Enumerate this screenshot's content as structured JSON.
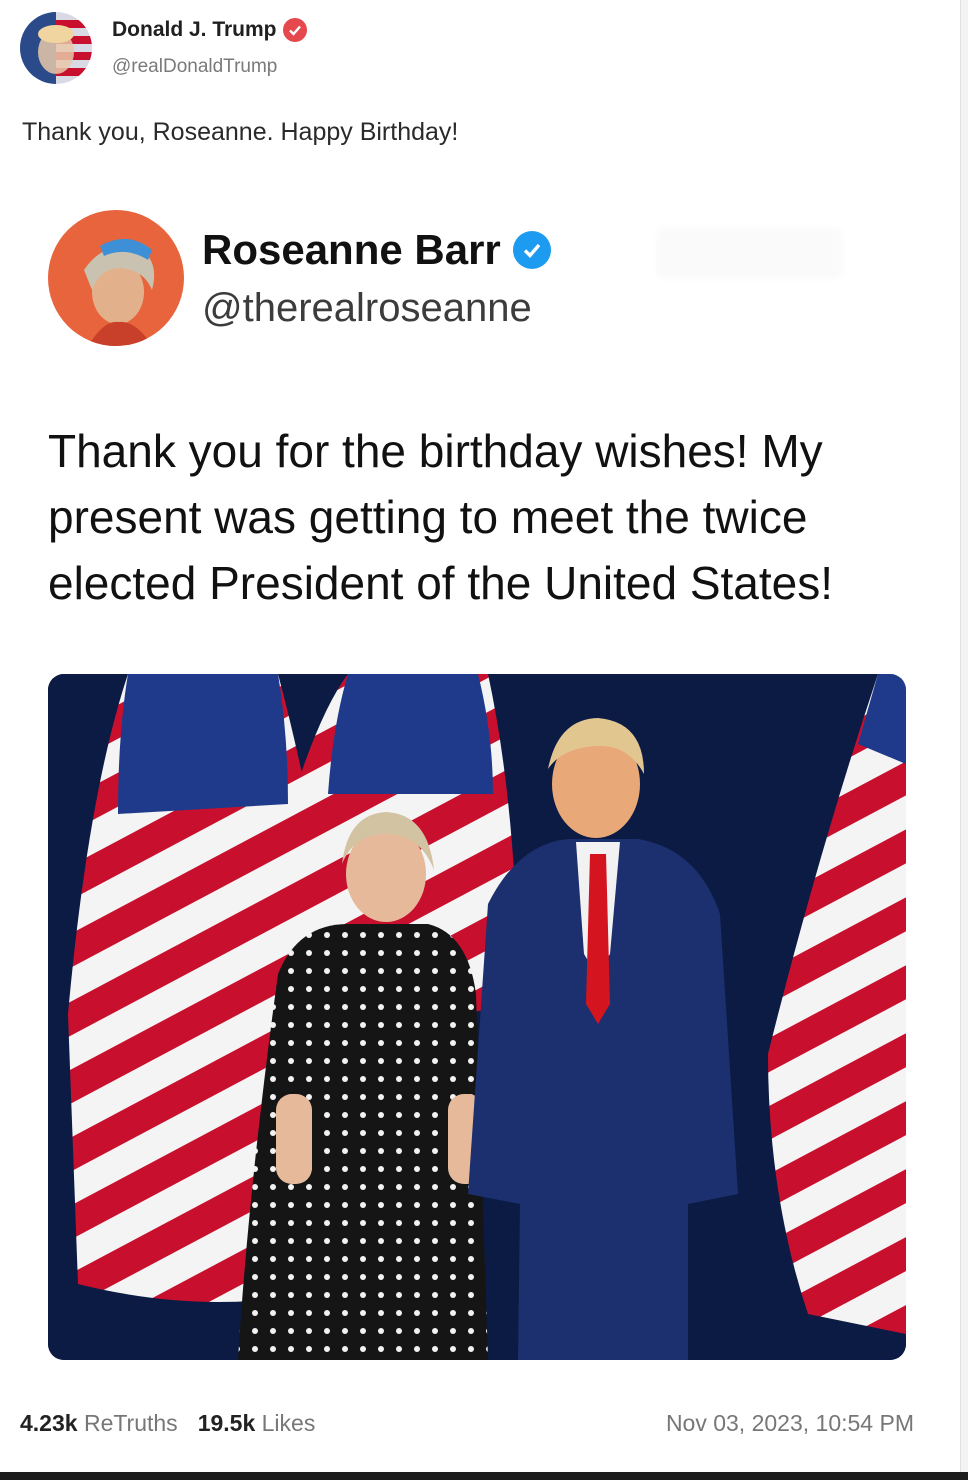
{
  "author": {
    "name": "Donald J. Trump",
    "handle": "@realDonaldTrump",
    "verified_badge_color": "#e5484d"
  },
  "post": {
    "text": "Thank you, Roseanne. Happy Birthday!"
  },
  "embedded": {
    "name": "Roseanne Barr",
    "handle": "@therealroseanne",
    "verified_badge_color": "#1d9bf0",
    "text": "Thank you for the birthday wishes! My present was getting to meet the twice elected President of the United States!",
    "image_icon": "photo-icon"
  },
  "footer": {
    "retruths_count": "4.23k",
    "retruths_label": "ReTruths",
    "likes_count": "19.5k",
    "likes_label": "Likes",
    "timestamp": "Nov 03, 2023, 10:54 PM"
  }
}
